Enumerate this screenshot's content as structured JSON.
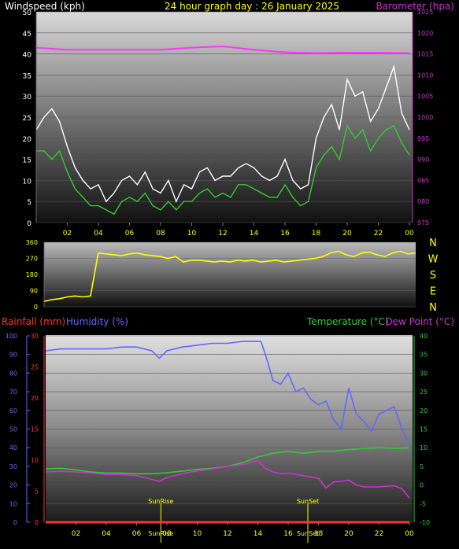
{
  "chart_data": [
    {
      "type": "line",
      "title": "24 hour graph day : 26 January 2025",
      "left_axis_label": "Windspeed (kph)",
      "right_axis_label": "Barometer (hpa)",
      "x_ticks": [
        "02",
        "04",
        "06",
        "08",
        "10",
        "12",
        "14",
        "16",
        "18",
        "20",
        "22",
        "00"
      ],
      "left_ticks": [
        0,
        5,
        10,
        15,
        20,
        25,
        30,
        35,
        40,
        45,
        50
      ],
      "right_ticks": [
        975,
        980,
        985,
        990,
        995,
        1000,
        1005,
        1010,
        1015,
        1020,
        1025
      ],
      "left_range": [
        0,
        50
      ],
      "right_range": [
        975,
        1025
      ],
      "colors": {
        "gust": "#ffffff",
        "windspeed": "#33cc33",
        "barometer": "#ff33ff",
        "left_text": "#ffffff",
        "right_text": "#cc33cc",
        "title_text": "#ffff00"
      },
      "series": [
        {
          "key": "gust",
          "axis": "left",
          "x": [
            0,
            0.5,
            1,
            1.5,
            2,
            2.5,
            3,
            3.5,
            4,
            4.5,
            5,
            5.5,
            6,
            6.5,
            7,
            7.5,
            8,
            8.5,
            9,
            9.5,
            10,
            10.5,
            11,
            11.5,
            12,
            12.5,
            13,
            13.5,
            14,
            14.5,
            15,
            15.5,
            16,
            16.5,
            17,
            17.5,
            18,
            18.5,
            19,
            19.5,
            20,
            20.5,
            21,
            21.5,
            22,
            22.5,
            23,
            23.5,
            24
          ],
          "values": [
            22,
            25,
            27,
            24,
            18,
            13,
            10,
            8,
            9,
            5,
            7,
            10,
            11,
            9,
            12,
            8,
            7,
            10,
            5,
            9,
            8,
            12,
            13,
            10,
            11,
            11,
            13,
            14,
            13,
            11,
            10,
            11,
            15,
            10,
            8,
            9,
            20,
            25,
            28,
            22,
            34,
            30,
            31,
            24,
            27,
            32,
            37,
            26,
            22
          ]
        },
        {
          "key": "windspeed",
          "axis": "left",
          "x": [
            0,
            0.5,
            1,
            1.5,
            2,
            2.5,
            3,
            3.5,
            4,
            4.5,
            5,
            5.5,
            6,
            6.5,
            7,
            7.5,
            8,
            8.5,
            9,
            9.5,
            10,
            10.5,
            11,
            11.5,
            12,
            12.5,
            13,
            13.5,
            14,
            14.5,
            15,
            15.5,
            16,
            16.5,
            17,
            17.5,
            18,
            18.5,
            19,
            19.5,
            20,
            20.5,
            21,
            21.5,
            22,
            22.5,
            23,
            23.5,
            24
          ],
          "values": [
            17,
            17,
            15,
            17,
            12,
            8,
            6,
            4,
            4,
            3,
            2,
            5,
            6,
            5,
            7,
            4,
            3,
            5,
            3,
            5,
            5,
            7,
            8,
            6,
            7,
            6,
            9,
            9,
            8,
            7,
            6,
            6,
            9,
            6,
            4,
            5,
            13,
            16,
            18,
            15,
            23,
            20,
            22,
            17,
            20,
            22,
            23,
            19,
            16
          ]
        },
        {
          "key": "barometer",
          "axis": "right",
          "x": [
            0,
            2,
            4,
            6,
            8,
            10,
            12,
            14,
            16,
            18,
            20,
            22,
            24
          ],
          "values": [
            1016.5,
            1016,
            1016,
            1016,
            1016,
            1016.5,
            1016.8,
            1016,
            1015.4,
            1015.2,
            1015.3,
            1015.3,
            1015.2
          ]
        }
      ]
    },
    {
      "type": "scatter",
      "title": "",
      "x_ticks": [
        "02",
        "04",
        "06",
        "08",
        "10",
        "12",
        "14",
        "16",
        "18",
        "20",
        "22",
        "00"
      ],
      "left_ticks": [
        0,
        90,
        180,
        270,
        360
      ],
      "left_range": [
        0,
        360
      ],
      "compass_labels": [
        "N",
        "W",
        "S",
        "E",
        "N"
      ],
      "colors": {
        "direction": "#ffff00",
        "text": "#ffff00"
      },
      "series": [
        {
          "key": "direction",
          "x": [
            0,
            0.5,
            1,
            1.5,
            2,
            2.5,
            3,
            3.5,
            4,
            4.5,
            5,
            5.5,
            6,
            6.5,
            7,
            7.5,
            8,
            8.5,
            9,
            9.5,
            10,
            10.5,
            11,
            11.5,
            12,
            12.5,
            13,
            13.5,
            14,
            14.5,
            15,
            15.5,
            16,
            16.5,
            17,
            17.5,
            18,
            18.5,
            19,
            19.5,
            20,
            20.5,
            21,
            21.5,
            22,
            22.5,
            23,
            23.5,
            24
          ],
          "values": [
            30,
            40,
            45,
            55,
            60,
            55,
            60,
            300,
            295,
            290,
            285,
            295,
            300,
            290,
            285,
            280,
            270,
            280,
            250,
            260,
            260,
            255,
            250,
            255,
            250,
            260,
            255,
            260,
            250,
            255,
            260,
            250,
            255,
            260,
            265,
            270,
            280,
            300,
            310,
            290,
            280,
            300,
            305,
            290,
            280,
            300,
            310,
            295,
            300
          ]
        }
      ]
    },
    {
      "type": "line",
      "title": "",
      "labels": {
        "rainfall": "Rainfall (mm)",
        "humidity": "Humidity (%)",
        "temperature": "Temperature (°C)",
        "dewpoint": "Dew Point (°C)",
        "sunrise": "SunRise",
        "sunset": "SunSet"
      },
      "x_ticks": [
        "02",
        "04",
        "06",
        "08",
        "10",
        "12",
        "14",
        "16",
        "18",
        "20",
        "22",
        "00"
      ],
      "humidity_ticks": [
        0,
        10,
        20,
        30,
        40,
        50,
        60,
        70,
        80,
        90,
        100
      ],
      "rain_ticks": [
        0,
        5,
        10,
        15,
        20,
        25,
        30
      ],
      "temp_ticks": [
        -10,
        -5,
        0,
        5,
        10,
        15,
        20,
        25,
        30,
        35,
        40
      ],
      "humidity_range": [
        0,
        100
      ],
      "rain_range": [
        0,
        30
      ],
      "temp_range": [
        -10,
        40
      ],
      "sunrise_hour": 7.6,
      "sunset_hour": 17.3,
      "colors": {
        "rainfall": "#ff3333",
        "humidity": "#6666ff",
        "temperature": "#33cc33",
        "dewpoint": "#cc33cc",
        "sun": "#ffff00"
      },
      "series": [
        {
          "key": "humidity",
          "axis": "humidity",
          "x": [
            0,
            1,
            2,
            3,
            4,
            5,
            6,
            7,
            7.5,
            8,
            9,
            10,
            11,
            12,
            13,
            13.8,
            14.2,
            14.5,
            15,
            15.5,
            16,
            16.5,
            17,
            17.5,
            18,
            18.5,
            19,
            19.5,
            20,
            20.5,
            21,
            21.5,
            22,
            22.5,
            23,
            23.5,
            24
          ],
          "values": [
            92,
            93,
            93,
            93,
            93,
            94,
            94,
            92,
            88,
            92,
            94,
            95,
            96,
            96,
            97,
            97,
            97,
            90,
            76,
            74,
            80,
            70,
            72,
            66,
            63,
            65,
            55,
            50,
            72,
            58,
            54,
            49,
            58,
            60,
            62,
            50,
            42
          ]
        },
        {
          "key": "temperature",
          "axis": "temp",
          "x": [
            0,
            1,
            2,
            3,
            4,
            5,
            6,
            7,
            8,
            9,
            10,
            11,
            12,
            13,
            14,
            15,
            16,
            17,
            18,
            19,
            20,
            21,
            22,
            23,
            24
          ],
          "values": [
            4.3,
            4.5,
            4,
            3.5,
            3.2,
            3.2,
            3,
            3,
            3.3,
            3.7,
            4.2,
            4.5,
            5,
            6,
            7.5,
            8.5,
            9,
            8.5,
            9,
            9,
            9.5,
            9.8,
            10,
            9.8,
            10
          ]
        },
        {
          "key": "dewpoint",
          "axis": "temp",
          "x": [
            0,
            1,
            2,
            3,
            4,
            5,
            6,
            7,
            7.5,
            8,
            9,
            10,
            11,
            12,
            13,
            14,
            14.5,
            15,
            15.5,
            16,
            17,
            18,
            18.5,
            19,
            19.5,
            20,
            20.5,
            21,
            22,
            23,
            23.5,
            24
          ],
          "values": [
            3.5,
            3.7,
            3.5,
            3.2,
            2.8,
            2.8,
            2.5,
            1.5,
            1,
            2,
            3,
            3.8,
            4.3,
            5,
            5.5,
            6.5,
            4.5,
            3.5,
            3,
            3.2,
            2.5,
            1.8,
            -0.8,
            0.8,
            1,
            1.3,
            0,
            -0.5,
            -0.5,
            -0.2,
            -1,
            -3.5
          ]
        },
        {
          "key": "rainfall",
          "axis": "rain",
          "x": [
            0,
            24
          ],
          "values": [
            0,
            0
          ]
        }
      ]
    }
  ]
}
